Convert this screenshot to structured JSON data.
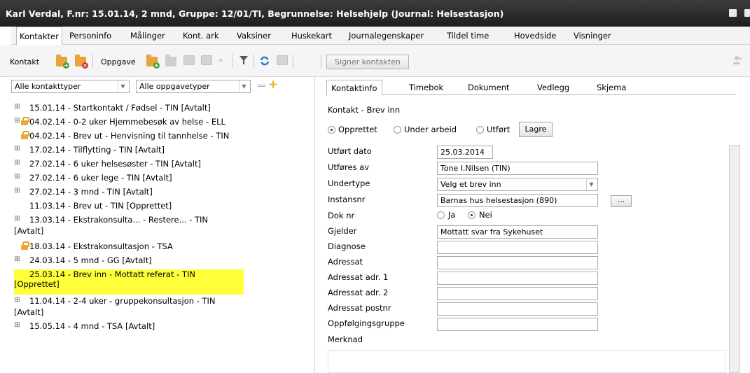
{
  "window": {
    "title": "Karl Verdal, F.nr: 15.01.14, 2 mnd, Gruppe: 12/01/TI, Begrunnelse: Helsehjelp (Journal: Helsestasjon)"
  },
  "menu": {
    "items": [
      "Kontakter",
      "Personinfo",
      "Målinger",
      "Kont. ark",
      "Vaksiner",
      "Huskekart",
      "Journalegenskaper",
      "Tildel time",
      "Hovedside",
      "Visninger"
    ],
    "active_index": 0
  },
  "toolbar": {
    "kontakt_label": "Kontakt",
    "oppgave_label": "Oppgave",
    "sign_button": "Signer kontakten"
  },
  "filters": {
    "contact_types": "Alle kontakttyper",
    "task_types": "Alle oppgavetyper"
  },
  "tree": {
    "items": [
      {
        "text": "15.01.14 - Startkontakt / Fødsel - TIN [Avtalt]"
      },
      {
        "text": "04.02.14 - 0-2 uker Hjemmebesøk av helse - ELL"
      },
      {
        "text": "04.02.14 - Brev ut - Henvisning til tannhelse - TIN"
      },
      {
        "text": "17.02.14 - Tilflytting - TIN [Avtalt]"
      },
      {
        "text": "27.02.14 - 6 uker helsesøster - TIN [Avtalt]"
      },
      {
        "text": "27.02.14 - 6 uker lege - TIN [Avtalt]"
      },
      {
        "text": "27.02.14 - 3 mnd - TIN [Avtalt]"
      },
      {
        "text": "11.03.14 - Brev ut - TIN [Opprettet]"
      },
      {
        "text": "13.03.14 - Ekstrakonsulta... - Restere... - TIN",
        "text2": "[Avtalt]"
      },
      {
        "text": "18.03.14 - Ekstrakonsultasjon - TSA"
      },
      {
        "text": "24.03.14 - 5 mnd - GG [Avtalt]"
      },
      {
        "text": "25.03.14 - Brev inn - Mottatt referat - TIN",
        "text2": "[Opprettet]"
      },
      {
        "text": "11.04.14 - 2-4 uker - gruppekonsultasjon - TIN",
        "text2": "[Avtalt]"
      },
      {
        "text": "15.05.14 - 4 mnd - TSA [Avtalt]"
      }
    ]
  },
  "tabs": {
    "items": [
      "Kontaktinfo",
      "Timebok",
      "Dokument",
      "Vedlegg",
      "Skjema"
    ],
    "active_index": 0
  },
  "form": {
    "heading": "Kontakt - Brev inn",
    "status_options": [
      "Opprettet",
      "Under arbeid",
      "Utført"
    ],
    "status_selected": "Opprettet",
    "save_button": "Lagre",
    "fields": {
      "utfort_dato": {
        "label": "Utført dato",
        "value": "25.03.2014"
      },
      "utfores_av": {
        "label": "Utføres av",
        "value": "Tone I.Nilsen (TIN)"
      },
      "undertype": {
        "label": "Undertype",
        "value": "Velg et brev inn"
      },
      "instansnr": {
        "label": "Instansnr",
        "value": "Barnas hus helsestasjon (890)"
      },
      "dok_nr": {
        "label": "Dok nr",
        "options": [
          "Ja",
          "Nei"
        ],
        "selected": "Nei"
      },
      "gjelder": {
        "label": "Gjelder",
        "value": "Mottatt svar fra Sykehuset"
      },
      "diagnose": {
        "label": "Diagnose",
        "value": ""
      },
      "adressat": {
        "label": "Adressat",
        "value": ""
      },
      "adressat_adr1": {
        "label": "Adressat adr. 1",
        "value": ""
      },
      "adressat_adr2": {
        "label": "Adressat adr. 2",
        "value": ""
      },
      "adressat_postnr": {
        "label": "Adressat postnr",
        "value": ""
      },
      "oppfolgingsgruppe": {
        "label": "Oppfølgingsgruppe",
        "value": ""
      },
      "merknad": {
        "label": "Merknad",
        "value": ""
      }
    },
    "browse_button": "..."
  },
  "colors": {
    "titlebar": "#2c2c2c",
    "highlight": "#ffff3a",
    "folder": "#e8a33a"
  }
}
